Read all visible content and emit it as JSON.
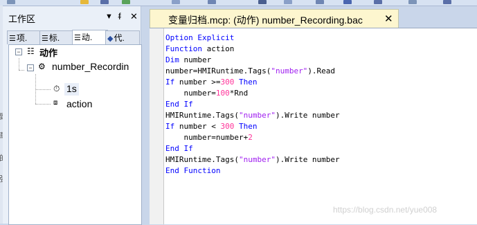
{
  "colors": {
    "keyword": "#0000ff",
    "string": "#a020f0",
    "number": "#ff3399",
    "text": "#000000"
  },
  "sidebar": {
    "title": "工作区",
    "dropdown_glyph": "▼",
    "pin_glyph": "ᵮ",
    "close_glyph": "✕",
    "tabs": [
      {
        "icon": "list-icon",
        "glyph": "☰",
        "label": "项."
      },
      {
        "icon": "tag-icon",
        "glyph": "☰",
        "label": "标."
      },
      {
        "icon": "action-icon",
        "glyph": "☰",
        "label": "动."
      },
      {
        "icon": "code-icon",
        "glyph": "◆",
        "label": "代."
      }
    ],
    "tree": {
      "root_label": "动作",
      "script_label": "number_Recordin",
      "trigger_label": "1s",
      "action_label": "action",
      "collapse_glyph": "−",
      "root_icon_glyph": "☷",
      "script_icon_glyph": "⚙",
      "trigger_icon_glyph": "⏱",
      "action_icon_glyph": "⧈"
    }
  },
  "left_edge_chars": [
    "致",
    "草",
    "的",
    "強"
  ],
  "editor": {
    "tab_title": "变量归档.mcp: (动作) number_Recording.bac",
    "tab_close": "✕",
    "lines": [
      [
        [
          "Option Explicit",
          "keyword"
        ]
      ],
      [
        [
          "Function",
          "keyword"
        ],
        [
          " action",
          "text"
        ]
      ],
      [
        [
          "Dim",
          "keyword"
        ],
        [
          " number",
          "text"
        ]
      ],
      [
        [
          "number=HMIRuntime.Tags(",
          "text"
        ],
        [
          "\"number\"",
          "string"
        ],
        [
          ").Read",
          "text"
        ]
      ],
      [
        [
          "If",
          "keyword"
        ],
        [
          " number >=",
          "text"
        ],
        [
          "300",
          "number"
        ],
        [
          " ",
          "text"
        ],
        [
          "Then",
          "keyword"
        ]
      ],
      [
        [
          "    number=",
          "text"
        ],
        [
          "100",
          "number"
        ],
        [
          "*Rnd",
          "text"
        ]
      ],
      [
        [
          "End If",
          "keyword"
        ]
      ],
      [
        [
          "HMIRuntime.Tags(",
          "text"
        ],
        [
          "\"number\"",
          "string"
        ],
        [
          ").Write number",
          "text"
        ]
      ],
      [
        [
          "If",
          "keyword"
        ],
        [
          " number < ",
          "text"
        ],
        [
          "300",
          "number"
        ],
        [
          " ",
          "text"
        ],
        [
          "Then",
          "keyword"
        ]
      ],
      [
        [
          "    number=number+",
          "text"
        ],
        [
          "2",
          "number"
        ]
      ],
      [
        [
          "End If",
          "keyword"
        ]
      ],
      [
        [
          "HMIRuntime.Tags(",
          "text"
        ],
        [
          "\"number\"",
          "string"
        ],
        [
          ").Write number",
          "text"
        ]
      ],
      [
        [
          "End Function",
          "keyword"
        ]
      ]
    ]
  },
  "watermark": "https://blog.csdn.net/yue008"
}
